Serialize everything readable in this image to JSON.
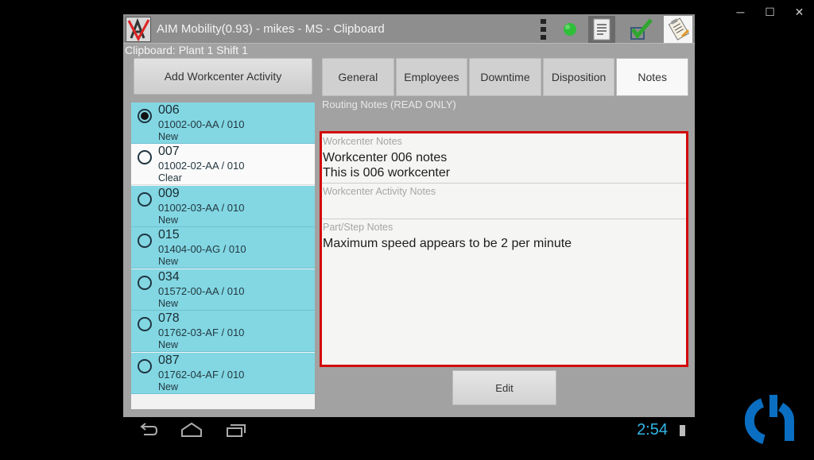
{
  "window": {
    "controls": {
      "minimize": "─",
      "maximize": "☐",
      "close": "✕"
    }
  },
  "app": {
    "title": "AIM Mobility(0.93) - mikes - MS - Clipboard",
    "subtitle": "Clipboard: Plant 1 Shift 1",
    "toolbar_icons": [
      "overflow-menu-icon",
      "status-green-dot-icon",
      "document-icon",
      "checkmark-icon",
      "clipboard-icon"
    ],
    "status_color": "#2fbf3a"
  },
  "sidebar": {
    "add_button": "Add Workcenter Activity",
    "items": [
      {
        "code": "006",
        "part": "01002-00-AA / 010",
        "status": "New",
        "selected": true
      },
      {
        "code": "007",
        "part": "01002-02-AA / 010",
        "status": "Clear",
        "selected": false
      },
      {
        "code": "009",
        "part": "01002-03-AA / 010",
        "status": "New",
        "selected": false
      },
      {
        "code": "015",
        "part": "01404-00-AG / 010",
        "status": "New",
        "selected": false
      },
      {
        "code": "034",
        "part": "01572-00-AA / 010",
        "status": "New",
        "selected": false
      },
      {
        "code": "078",
        "part": "01762-03-AF / 010",
        "status": "New",
        "selected": false
      },
      {
        "code": "087",
        "part": "01762-04-AF / 010",
        "status": "New",
        "selected": false
      }
    ]
  },
  "tabs": [
    {
      "label": "General",
      "active": false
    },
    {
      "label": "Employees",
      "active": false
    },
    {
      "label": "Downtime",
      "active": false
    },
    {
      "label": "Disposition",
      "active": false
    },
    {
      "label": "Notes",
      "active": true
    }
  ],
  "notes": {
    "routing_label": "Routing Notes (READ ONLY)",
    "workcenter_label": "Workcenter Notes",
    "workcenter_line1": "Workcenter 006 notes",
    "workcenter_line2": "This is 006 workcenter",
    "activity_label": "Workcenter Activity Notes",
    "activity_value": "",
    "part_label": "Part/Step Notes",
    "part_value": "Maximum speed appears to be 2 per minute",
    "edit_button": "Edit"
  },
  "navbar": {
    "clock": "2:54",
    "clock_color": "#33b5e5"
  },
  "brand": {
    "color": "#0a6fc2"
  }
}
